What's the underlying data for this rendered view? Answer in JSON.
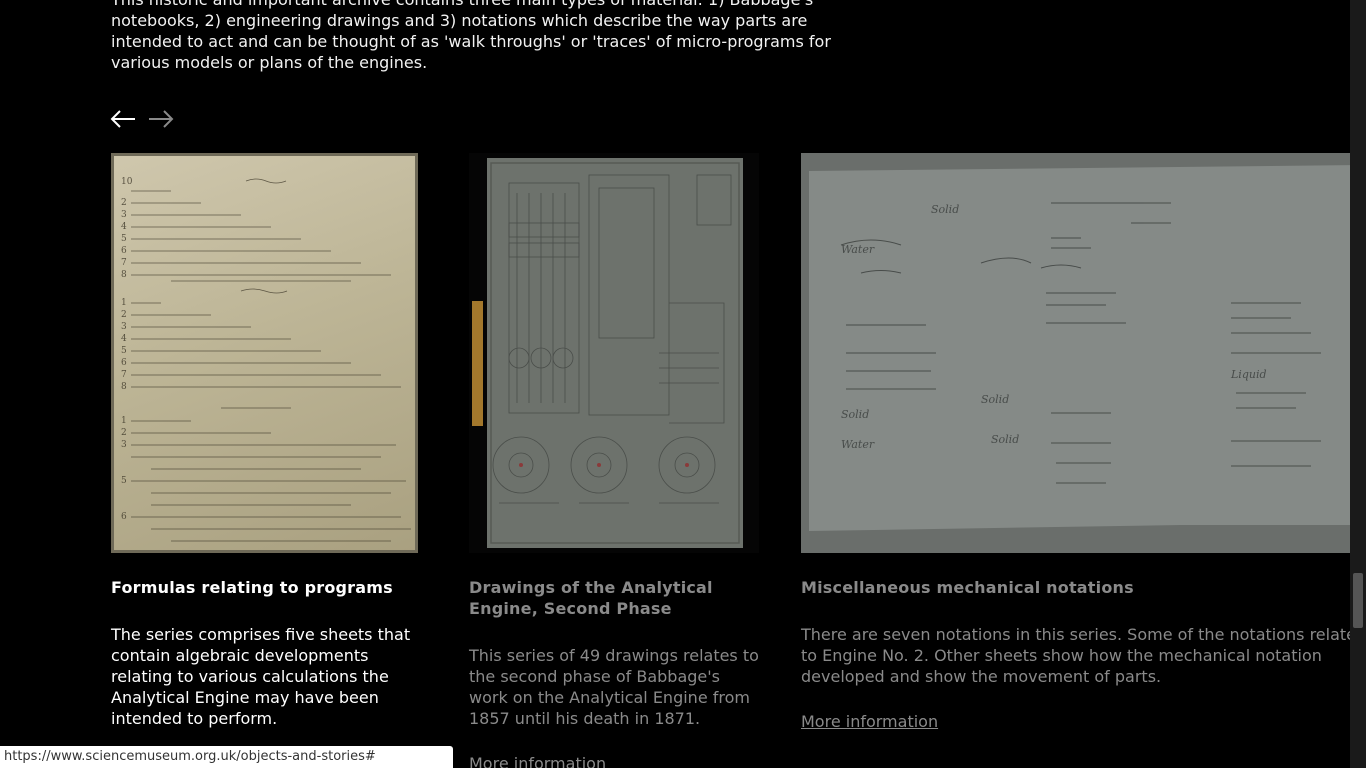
{
  "intro": {
    "text": "This historic and important archive contains three main types of material: 1) Babbage's notebooks, 2) engineering drawings and 3) notations which describe the way parts are intended to act and can be thought of as 'walk throughs' or 'traces' of micro-programs for various models or plans of the engines."
  },
  "carousel": {
    "prev_label": "Previous",
    "next_label": "Next",
    "cards": [
      {
        "title": "Formulas relating to programs",
        "description": "The series comprises five sheets that contain algebraic developments relating to various calculations the Analytical Engine may have been intended to perform.",
        "link": ""
      },
      {
        "title": "Drawings of the Analytical Engine, Second Phase",
        "description": "This series of 49 drawings relates to the second phase of Babbage's work on the Analytical Engine from 1857 until his death in 1871.",
        "link": "More information"
      },
      {
        "title": "Miscellaneous mechanical notations",
        "description": "There are seven notations in this series. Some of the notations relate to Engine No. 2. Other sheets show how the mechanical notation developed and show the movement of parts.",
        "link": "More information"
      }
    ]
  },
  "status_bar": {
    "url": "https://www.sciencemuseum.org.uk/objects-and-stories#"
  }
}
